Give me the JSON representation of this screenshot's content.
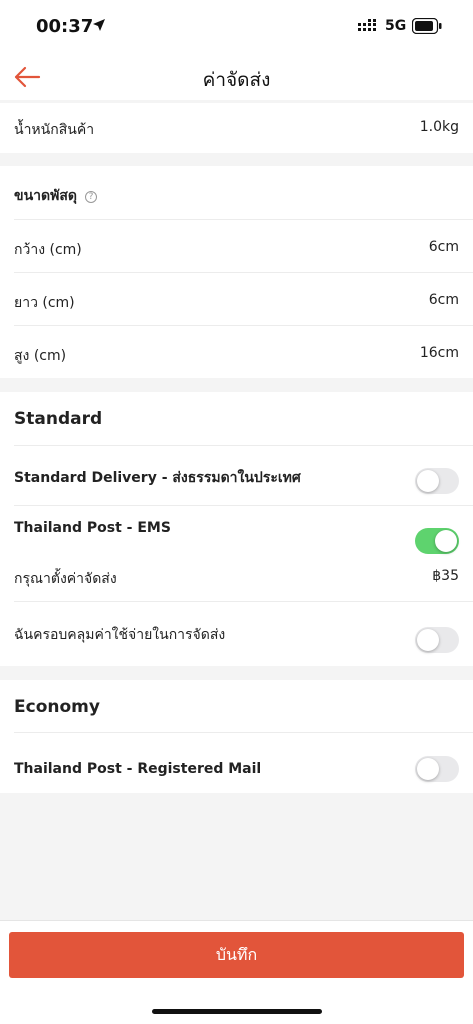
{
  "status": {
    "time": "00:37",
    "network": "5G"
  },
  "nav": {
    "title": "ค่าจัดส่ง"
  },
  "weight": {
    "label": "น้ำหนักสินค้า",
    "value": "1.0kg"
  },
  "parcel": {
    "title": "ขนาดพัสดุ",
    "help_icon": "?",
    "rows": [
      {
        "label": "กว้าง (cm)",
        "value": "6cm"
      },
      {
        "label": "ยาว (cm)",
        "value": "6cm"
      },
      {
        "label": "สูง (cm)",
        "value": "16cm"
      }
    ]
  },
  "standard": {
    "title": "Standard",
    "delivery_label": "Standard Delivery - ส่งธรรมดาในประเทศ",
    "delivery_enabled": false,
    "ems_label": "Thailand Post - EMS",
    "ems_enabled": true,
    "fee_label": "กรุณาตั้งค่าจัดส่ง",
    "fee_value": "฿35",
    "cover_label": "ฉันครอบคลุมค่าใช้จ่ายในการจัดส่ง",
    "cover_enabled": false
  },
  "economy": {
    "title": "Economy",
    "registered_label": "Thailand Post - Registered Mail",
    "registered_enabled": false
  },
  "footer": {
    "save_label": "บันทึก"
  },
  "colors": {
    "accent": "#e2553a",
    "toggle_on": "#5ed36e",
    "toggle_off": "#e9e9eb"
  }
}
